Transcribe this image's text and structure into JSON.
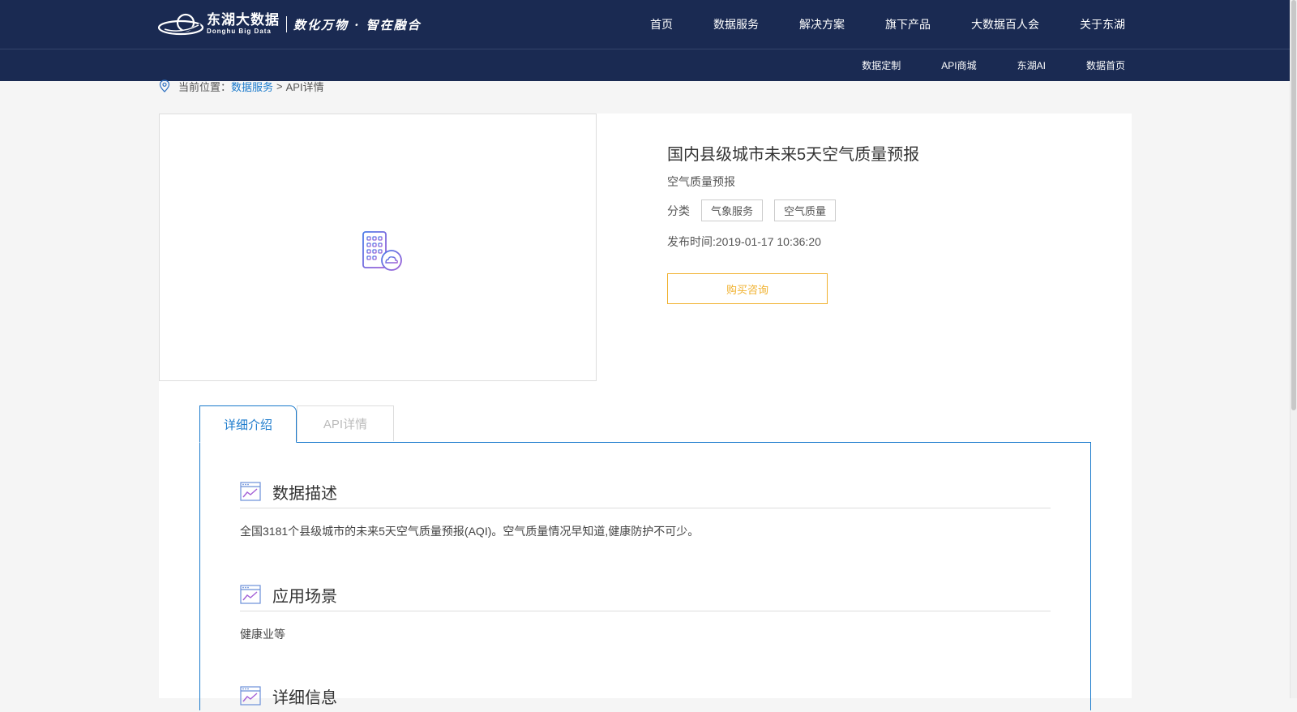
{
  "header": {
    "logo_cn": "东湖大数据",
    "logo_en": "Donghu Big Data",
    "slogan": "数化万物 · 智在融合",
    "nav": [
      "首页",
      "数据服务",
      "解决方案",
      "旗下产品",
      "大数据百人会",
      "关于东湖"
    ],
    "subnav": [
      "数据定制",
      "API商城",
      "东湖AI",
      "数据首页"
    ]
  },
  "breadcrumb": {
    "prefix": "当前位置：",
    "link": "数据服务",
    "separator": ">",
    "current": "API详情"
  },
  "product": {
    "title": "国内县级城市未来5天空气质量预报",
    "subtitle": "空气质量预报",
    "category_label": "分类",
    "tags": [
      "气象服务",
      "空气质量"
    ],
    "publish_time": "发布时间:2019-01-17 10:36:20",
    "buy_button": "购买咨询"
  },
  "tabs": [
    "详细介绍",
    "API详情"
  ],
  "sections": [
    {
      "title": "数据描述",
      "body": "全国3181个县级城市的未来5天空气质量预报(AQI)。空气质量情况早知道,健康防护不可少。"
    },
    {
      "title": "应用场景",
      "body": "健康业等"
    },
    {
      "title": "详细信息",
      "body": ""
    }
  ],
  "colors": {
    "header_bg": "#1a2a52",
    "link_blue": "#1a7acc",
    "accent_orange": "#f0b12e"
  }
}
